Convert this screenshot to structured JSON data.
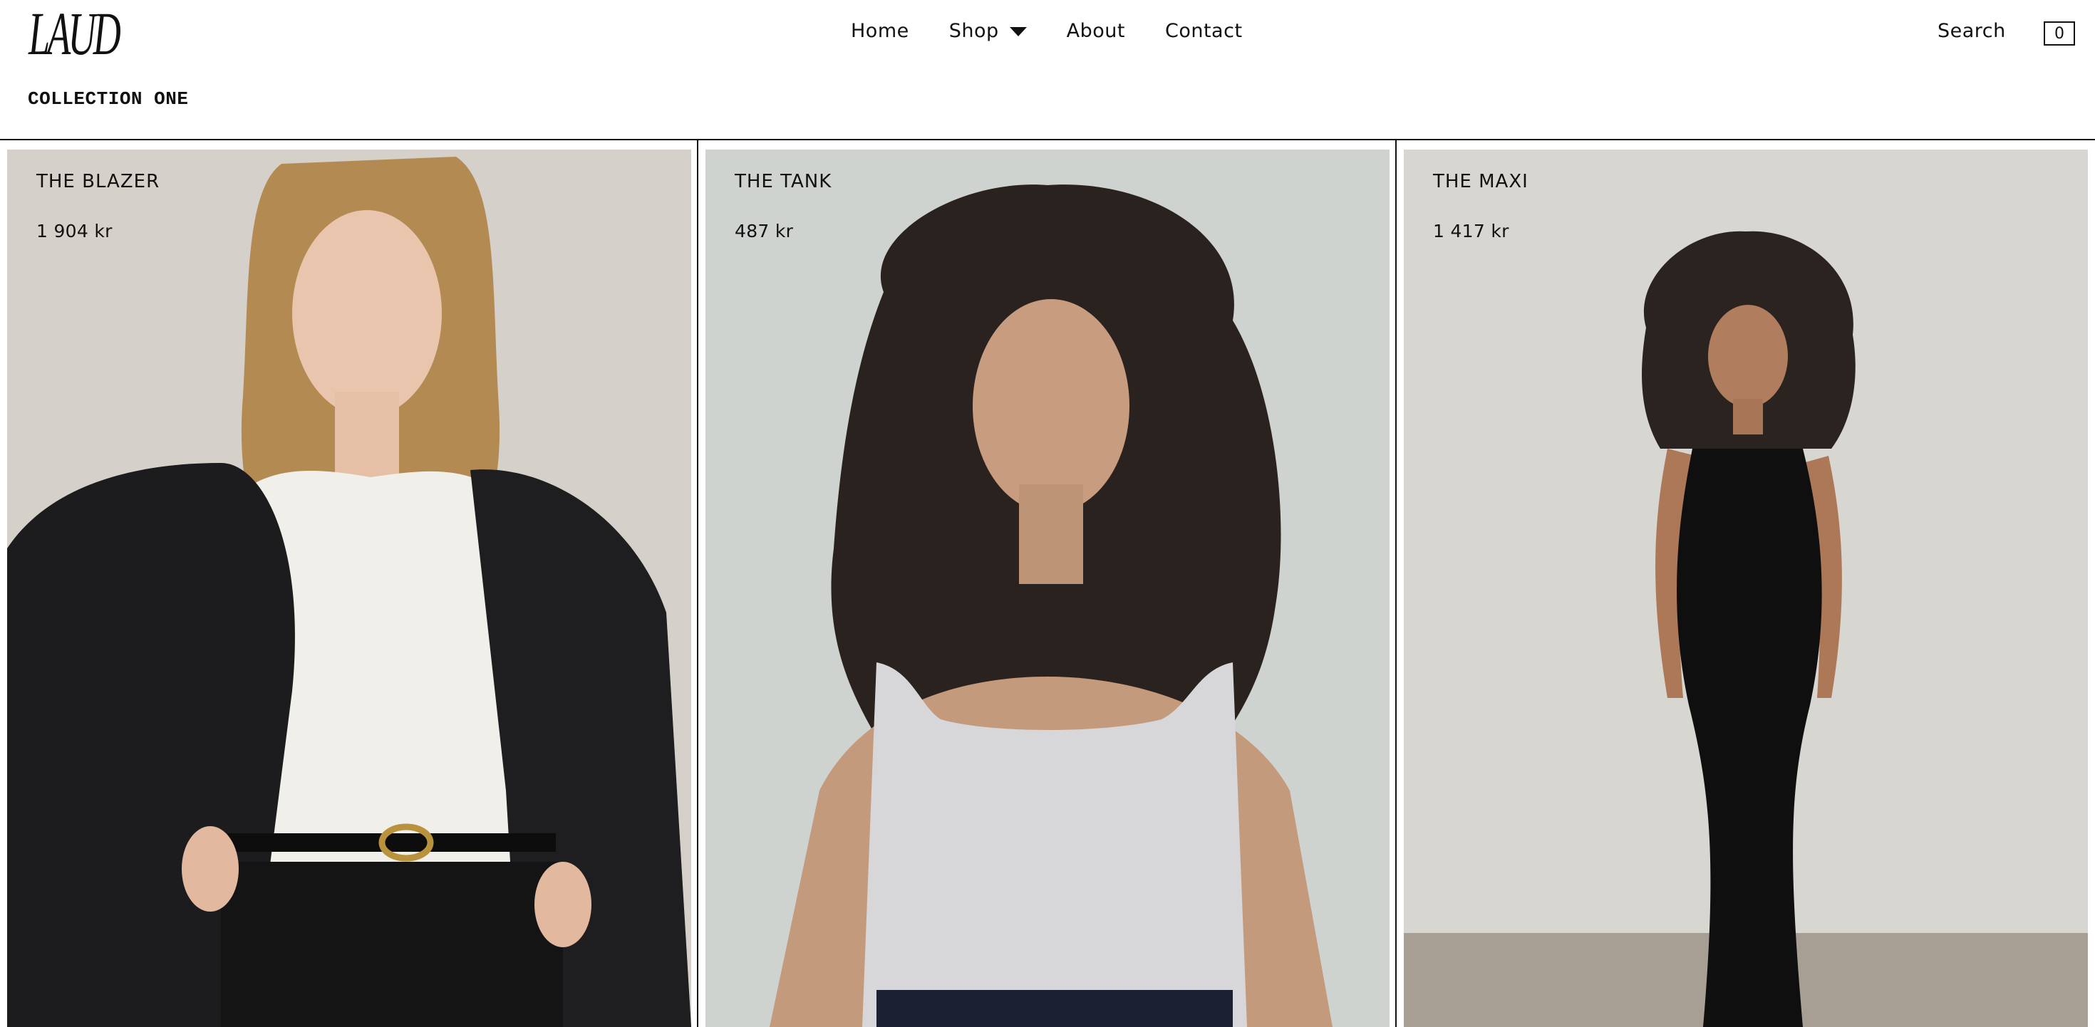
{
  "brand": {
    "name": "LAUD"
  },
  "nav": {
    "items": [
      {
        "label": "Home"
      },
      {
        "label": "Shop"
      },
      {
        "label": "About"
      },
      {
        "label": "Contact"
      }
    ],
    "search_label": "Search",
    "cart_count": "0"
  },
  "page": {
    "collection_title": "COLLECTION ONE"
  },
  "products": [
    {
      "title": "THE BLAZER",
      "price": "1 904 kr"
    },
    {
      "title": "THE TANK",
      "price": "487 kr"
    },
    {
      "title": "THE MAXI",
      "price": "1 417 kr"
    }
  ],
  "colors": {
    "text": "#111111",
    "background": "#ffffff",
    "rule": "#111111"
  },
  "icons": {
    "shop_dropdown": "caret-down-icon",
    "cart": "cart-count-box-icon"
  }
}
